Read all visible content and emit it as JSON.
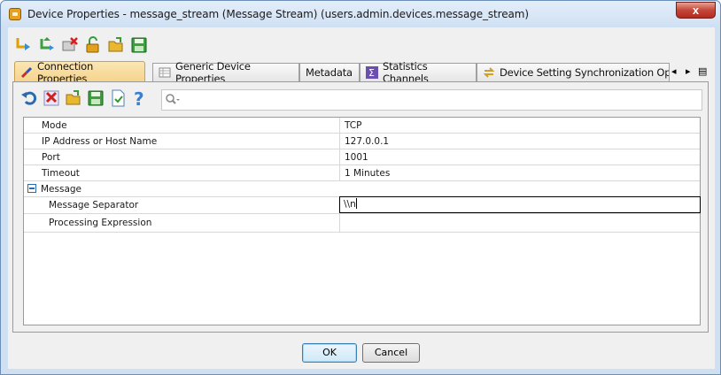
{
  "window": {
    "title": "Device Properties - message_stream (Message Stream) (users.admin.devices.message_stream)",
    "close_label": "x"
  },
  "top_toolbar": {
    "icons": [
      "link-arrow-icon",
      "refresh-green-icon",
      "delete-red-icon",
      "unlock-icon",
      "open-folder-icon",
      "save-icon"
    ]
  },
  "tabs": [
    {
      "label": "Connection Properties",
      "icon": "plug-icon",
      "active": true
    },
    {
      "label": "Generic Device Properties",
      "icon": "table-icon",
      "active": false
    },
    {
      "label": "Metadata",
      "icon": "",
      "active": false
    },
    {
      "label": "Statistics Channels",
      "icon": "sigma-icon",
      "active": false
    },
    {
      "label": "Device Setting Synchronization Option",
      "icon": "sync-icon",
      "active": false
    }
  ],
  "tab_nav": {
    "prev": "◂",
    "next": "▸",
    "menu": "▤"
  },
  "inner_toolbar": {
    "icons": [
      "undo-icon",
      "clear-red-icon",
      "open-folder-icon",
      "save-icon",
      "verify-doc-icon",
      "help-icon"
    ]
  },
  "search": {
    "value": "",
    "placeholder": ""
  },
  "properties": [
    {
      "name": "Mode",
      "value": "TCP"
    },
    {
      "name": "IP Address or Host Name",
      "value": "127.0.0.1"
    },
    {
      "name": "Port",
      "value": "1001"
    },
    {
      "name": "Timeout",
      "value": "1 Minutes"
    }
  ],
  "group": {
    "label": "Message",
    "expanded": true,
    "rows": [
      {
        "name": "Message Separator",
        "value": "\\\\n",
        "editing": true
      },
      {
        "name": "Processing Expression",
        "value": ""
      }
    ]
  },
  "buttons": {
    "ok": "OK",
    "cancel": "Cancel"
  },
  "colors": {
    "titlebar": "#cfe0f3",
    "active_tab": "#f5d38a",
    "close": "#c4463a"
  }
}
